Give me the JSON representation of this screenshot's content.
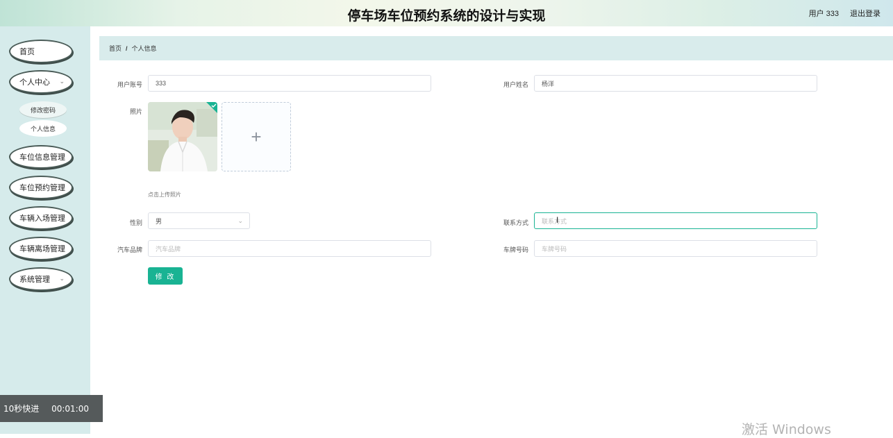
{
  "header": {
    "title": "停车场车位预约系统的设计与实现",
    "user_label": "用户 333",
    "logout_label": "退出登录"
  },
  "sidebar": {
    "items": [
      {
        "label": "首页"
      },
      {
        "label": "个人中心"
      },
      {
        "label": "车位信息管理"
      },
      {
        "label": "车位预约管理"
      },
      {
        "label": "车辆入场管理"
      },
      {
        "label": "车辆离场管理"
      },
      {
        "label": "系统管理"
      }
    ],
    "sub_items": [
      {
        "label": "修改密码"
      },
      {
        "label": "个人信息"
      }
    ]
  },
  "breadcrumb": {
    "home": "首页",
    "separator": "/",
    "current": "个人信息"
  },
  "form": {
    "account_label": "用户账号",
    "account_value": "333",
    "name_label": "用户姓名",
    "name_value": "杨洋",
    "photo_label": "照片",
    "upload_hint": "点击上传照片",
    "upload_plus": "+",
    "gender_label": "性别",
    "gender_value": "男",
    "phone_label": "联系方式",
    "phone_placeholder": "联系方式",
    "brand_label": "汽车品牌",
    "brand_placeholder": "汽车品牌",
    "plate_label": "车牌号码",
    "plate_placeholder": "车牌号码",
    "submit_label": "修 改"
  },
  "overlay": {
    "fast_forward": "10秒快进",
    "time": "00:01:00"
  },
  "watermark": "激活 Windows",
  "colors": {
    "accent": "#19b393",
    "sidebar_bg": "#d6ebeb",
    "breadcrumb_bg": "#d9ecec"
  }
}
